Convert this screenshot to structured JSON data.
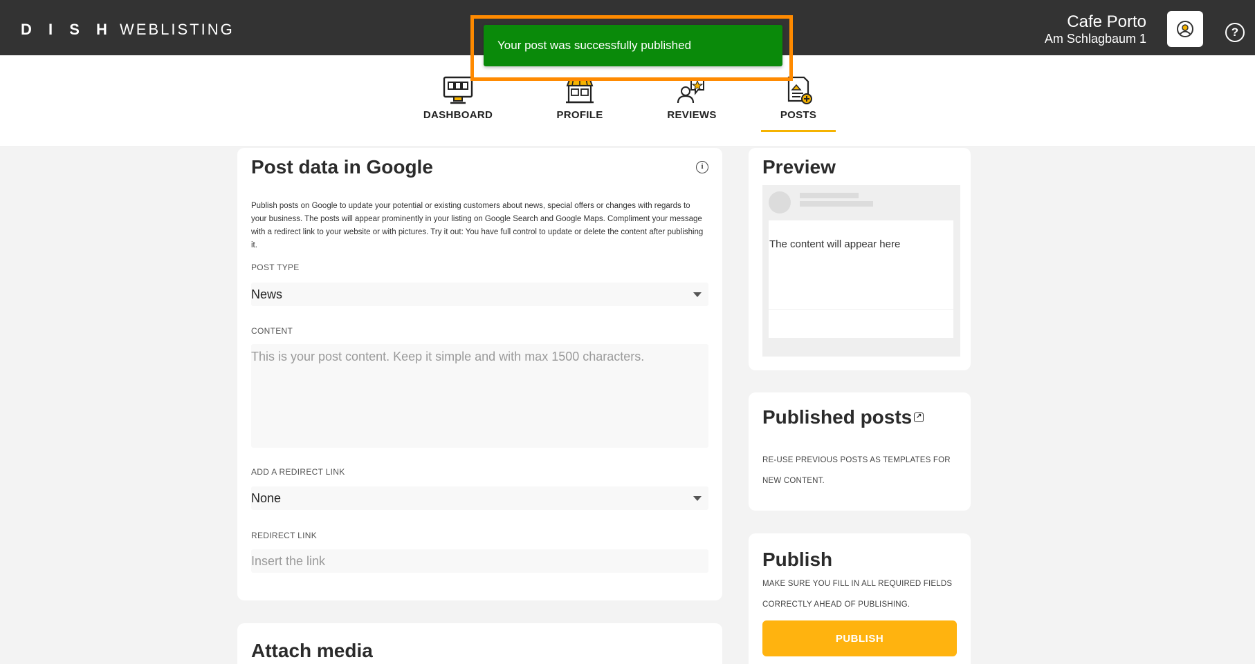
{
  "header": {
    "logo_bold": "D I S H",
    "logo_light": "WEBLISTING",
    "store_name": "Cafe Porto",
    "store_address": "Am Schlagbaum 1"
  },
  "nav": {
    "items": [
      {
        "label": "DASHBOARD",
        "icon": "monitor-icon"
      },
      {
        "label": "PROFILE",
        "icon": "store-icon"
      },
      {
        "label": "REVIEWS",
        "icon": "reviews-icon"
      },
      {
        "label": "POSTS",
        "icon": "post-add-icon"
      }
    ],
    "active": "POSTS"
  },
  "toast": {
    "message": "Your post was successfully published"
  },
  "post_form": {
    "title": "Post data in Google",
    "description": "Publish posts on Google to update your potential or existing customers about news, special offers or changes with regards to your business. The posts will appear prominently in your listing on Google Search and Google Maps. Compliment your message with a redirect link to your website or with pictures. Try it out: You have full control to update or delete the content after publishing it.",
    "post_type_label": "POST TYPE",
    "post_type_value": "News",
    "content_label": "CONTENT",
    "content_placeholder": "This is your post content. Keep it simple and with max 1500 characters.",
    "redirect_select_label": "ADD A REDIRECT LINK",
    "redirect_select_value": "None",
    "redirect_link_label": "REDIRECT LINK",
    "redirect_link_placeholder": "Insert the link"
  },
  "attach_media": {
    "title": "Attach media"
  },
  "preview": {
    "title": "Preview",
    "content_text": "The content will appear here"
  },
  "published_posts": {
    "title": "Published posts",
    "description": "RE-USE PREVIOUS POSTS AS TEMPLATES FOR NEW CONTENT."
  },
  "publish": {
    "title": "Publish",
    "description": "MAKE SURE YOU FILL IN ALL REQUIRED FIELDS CORRECTLY AHEAD OF PUBLISHING.",
    "button_label": "PUBLISH"
  },
  "colors": {
    "topbar": "#333333",
    "accent": "#ffb30f",
    "toast": "#0a8a0a",
    "highlight_frame": "#ff8a00"
  }
}
